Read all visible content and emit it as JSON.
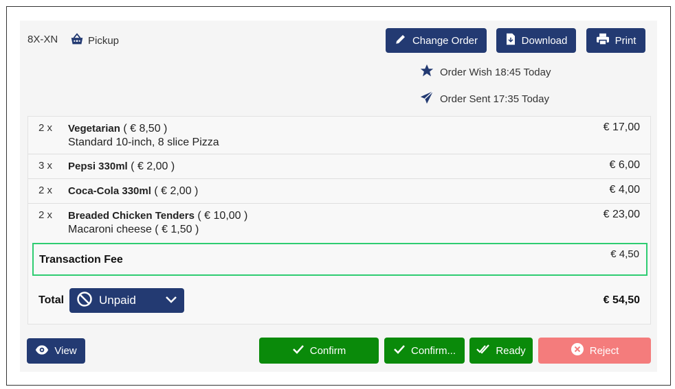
{
  "order": {
    "id": "8X-XN",
    "type": "Pickup"
  },
  "toolbar": {
    "change_order": "Change Order",
    "download": "Download",
    "print": "Print"
  },
  "meta": {
    "order_wish": "Order Wish 18:45 Today",
    "order_sent": "Order Sent 17:35 Today"
  },
  "items": [
    {
      "qty": "2 x",
      "name": "Vegetarian",
      "unit": "( € 8,50 )",
      "sub": "Standard 10-inch, 8 slice Pizza",
      "price": "€ 17,00"
    },
    {
      "qty": "3 x",
      "name": "Pepsi 330ml",
      "unit": "( € 2,00 )",
      "sub": "",
      "price": "€ 6,00"
    },
    {
      "qty": "2 x",
      "name": "Coca-Cola 330ml",
      "unit": "( € 2,00 )",
      "sub": "",
      "price": "€ 4,00"
    },
    {
      "qty": "2 x",
      "name": "Breaded Chicken Tenders",
      "unit": "( € 10,00 )",
      "sub": "Macaroni cheese ( € 1,50 )",
      "price": "€ 23,00"
    }
  ],
  "fee": {
    "label": "Transaction Fee",
    "price": "€ 4,50"
  },
  "total": {
    "label": "Total",
    "status": "Unpaid",
    "amount": "€ 54,50"
  },
  "actions": {
    "view": "View",
    "confirm": "Confirm",
    "confirm_more": "Confirm...",
    "ready": "Ready",
    "reject": "Reject"
  },
  "colors": {
    "navy": "#233a72",
    "green": "#0a8a0a",
    "reject": "#f47c7c",
    "fee_border": "#2ecc71"
  },
  "icons": {
    "pickup": "basket-icon",
    "change_order": "pencil-icon",
    "download": "file-download-icon",
    "print": "printer-icon",
    "wish": "star-icon",
    "sent": "paper-plane-icon",
    "unpaid": "ban-icon",
    "dropdown": "chevron-down-icon",
    "view": "eye-icon",
    "confirm": "check-icon",
    "ready": "double-check-icon",
    "reject": "close-circle-icon"
  }
}
